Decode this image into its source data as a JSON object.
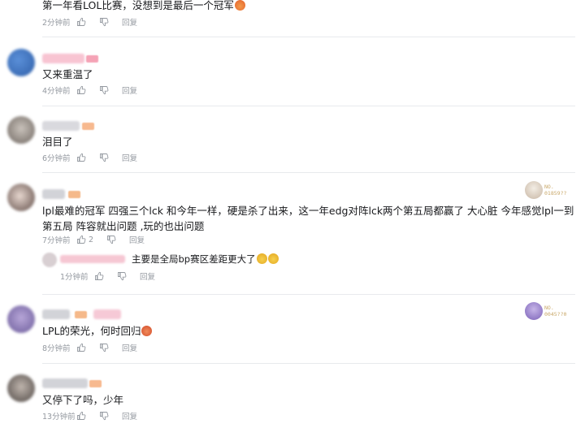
{
  "actions": {
    "reply_label": "回复"
  },
  "comments": [
    {
      "id": "c1",
      "text": "第一年看LOL比赛，没想到是最后一个冠军",
      "time": "2分钟前",
      "likes": ""
    },
    {
      "id": "c2",
      "text": "又来重温了",
      "time": "4分钟前",
      "likes": ""
    },
    {
      "id": "c3",
      "text": "泪目了",
      "time": "6分钟前",
      "likes": ""
    },
    {
      "id": "c4",
      "text": "lpl最难的冠军  四强三个lck 和今年一样，硬是杀了出来，这一年edg对阵lck两个第五局都赢了 大心脏 今年感觉lpl一到第五局 阵容就出问题 ,玩的也出问题",
      "time": "7分钟前",
      "likes": "2",
      "badge": {
        "number": "NO.\n01859??"
      },
      "reply": {
        "text": "主要是全局bp赛区差距更大了",
        "time": "1分钟前"
      }
    },
    {
      "id": "c5",
      "text": "LPL的荣光，何时回归",
      "time": "8分钟前",
      "likes": "",
      "badge": {
        "number": "NO.\n0045??0"
      }
    },
    {
      "id": "c6",
      "text": "又停下了吗，少年",
      "time": "13分钟前",
      "likes": ""
    }
  ],
  "colors": {
    "meta": "#9499a0",
    "separator": "#e8eaed",
    "username_pink": "#fb7299"
  }
}
